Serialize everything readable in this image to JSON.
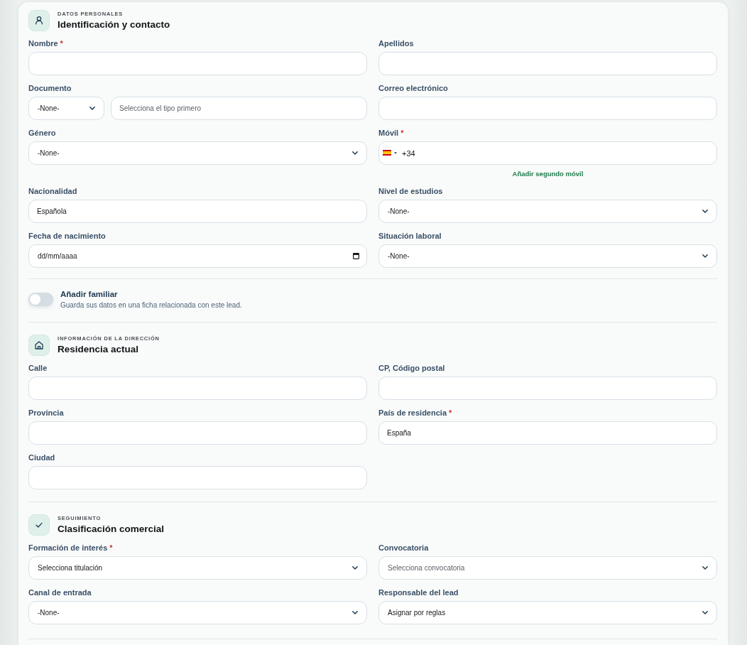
{
  "sections": [
    {
      "eyebrow": "DATOS PERSONALES",
      "title": "Identificación y contacto",
      "fields": [
        {
          "kind": "text",
          "label": "Nombre",
          "required_mark": "*"
        },
        {
          "kind": "text",
          "label": "Apellidos"
        },
        {
          "kind": "document",
          "label": "Documento",
          "type_value": "-None-",
          "placeholder": "Selecciona el tipo primero"
        },
        {
          "kind": "text",
          "label": "Correo electrónico"
        },
        {
          "kind": "select",
          "label": "Género",
          "value": "-None-"
        },
        {
          "kind": "phone",
          "label": "Móvil",
          "required_mark": "*",
          "value": "+34",
          "link": "Añadir segundo móvil"
        },
        {
          "kind": "text",
          "label": "Nacionalidad",
          "value": "Española"
        },
        {
          "kind": "select",
          "label": "Nivel de estudios",
          "value": "-None-"
        },
        {
          "kind": "date",
          "label": "Fecha de nacimiento",
          "placeholder": "dd/mm/aaaa"
        },
        {
          "kind": "select",
          "label": "Situación laboral",
          "value": "-None-"
        }
      ],
      "toggle": {
        "title": "Añadir familiar",
        "description": "Guarda sus datos en una ficha relacionada con este lead.",
        "on": false
      }
    },
    {
      "eyebrow": "INFORMACIÓN DE LA DIRECCIÓN",
      "title": "Residencia actual",
      "fields": [
        {
          "kind": "text",
          "label": "Calle"
        },
        {
          "kind": "text",
          "label": "CP, Código postal"
        },
        {
          "kind": "text",
          "label": "Provincia"
        },
        {
          "kind": "text",
          "label": "País de residencia",
          "required_mark": "*",
          "value": "España"
        },
        {
          "kind": "text",
          "label": "Ciudad"
        }
      ]
    },
    {
      "eyebrow": "SEGUIMIENTO",
      "title": "Clasificación comercial",
      "fields": [
        {
          "kind": "select",
          "label": "Formación de interés",
          "required_mark": "*",
          "value": "Selecciona titulación"
        },
        {
          "kind": "select",
          "label": "Convocatoria",
          "placeholder": "Selecciona convocatoria"
        },
        {
          "kind": "select",
          "label": "Canal de entrada",
          "value": "-None-"
        },
        {
          "kind": "select",
          "label": "Responsable del lead",
          "value": "Asignar por reglas"
        }
      ]
    }
  ]
}
